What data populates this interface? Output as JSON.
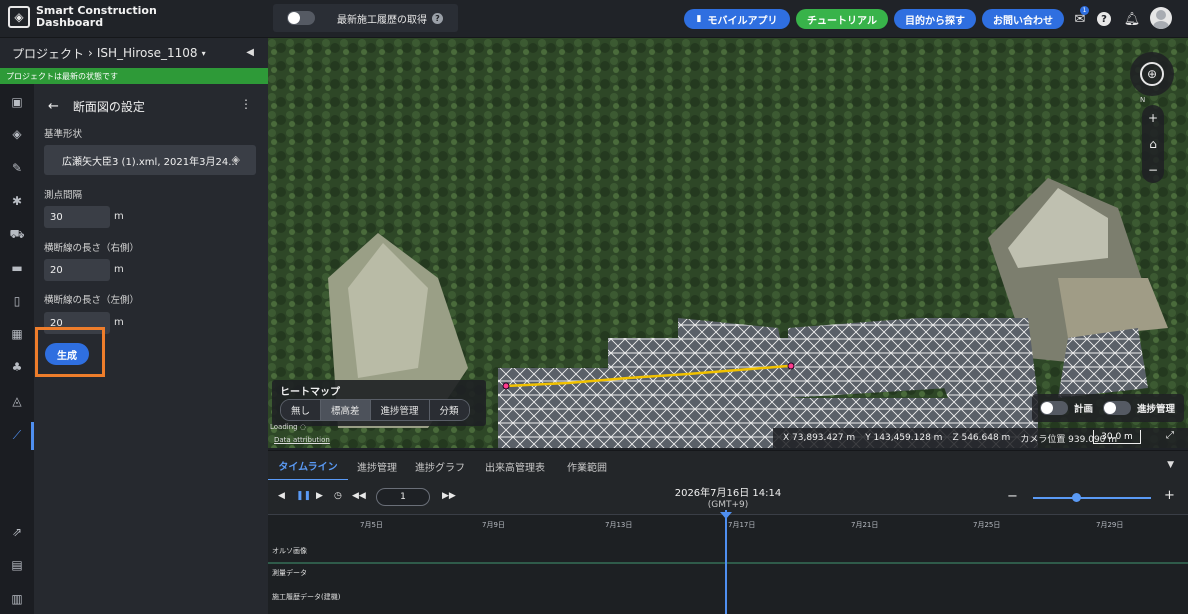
{
  "header": {
    "logo_line1": "Smart Construction",
    "logo_line2": "Dashboard",
    "toggle_label": "最新施工履歴の取得",
    "buttons": {
      "mobile_app": "モバイルアプリ",
      "tutorial": "チュートリアル",
      "find_by_purpose": "目的から探す",
      "contact": "お問い合わせ"
    },
    "notification_badge": "1"
  },
  "project": {
    "breadcrumb_prefix": "プロジェクト",
    "name": "ISH_Hirose_1108",
    "status": "プロジェクトは最新の状態です"
  },
  "panel": {
    "title": "断面図の設定",
    "base_shape_label": "基準形状",
    "base_shape_value": "広瀬矢大臣3 (1).xml, 2021年3月24...",
    "interval_label": "測点間隔",
    "interval_value": "30",
    "right_length_label": "横断線の長さ（右側）",
    "right_length_value": "20",
    "left_length_label": "横断線の長さ（左側）",
    "left_length_value": "20",
    "unit": "m",
    "generate_button": "生成"
  },
  "map": {
    "heatmap_title": "ヒートマップ",
    "heatmap_options": [
      "無し",
      "標高差",
      "進捗管理",
      "分類"
    ],
    "heatmap_selected": "標高差",
    "loading_label": "Loading",
    "attribution": "Data attribution",
    "x_coord": "X 73,893.427 m",
    "y_coord": "Y 143,459.128 m",
    "z_coord": "Z 546.648 m",
    "camera_position": "カメラ位置 939.090 m",
    "scale": "30.0 m",
    "plan_toggle": "計画",
    "progress_toggle": "進捗管理",
    "compass_n": "N"
  },
  "timeline": {
    "tabs": [
      "タイムライン",
      "進捗管理",
      "進捗グラフ",
      "出来高管理表",
      "作業範囲"
    ],
    "active_tab": "タイムライン",
    "page_value": "1",
    "current_date": "2026年7月16日 14:14",
    "timezone": "(GMT+9)",
    "dates": [
      "7月5日",
      "7月9日",
      "7月13日",
      "7月17日",
      "7月21日",
      "7月25日",
      "7月29日"
    ],
    "rows": [
      "オルソ画像",
      "測量データ",
      "施工履歴データ(建機)"
    ]
  },
  "colors": {
    "accent_blue": "#2f6fe0",
    "tutorial_green": "#38b34a",
    "status_green": "#2e9a38",
    "highlight_orange": "#ee7d2b"
  }
}
